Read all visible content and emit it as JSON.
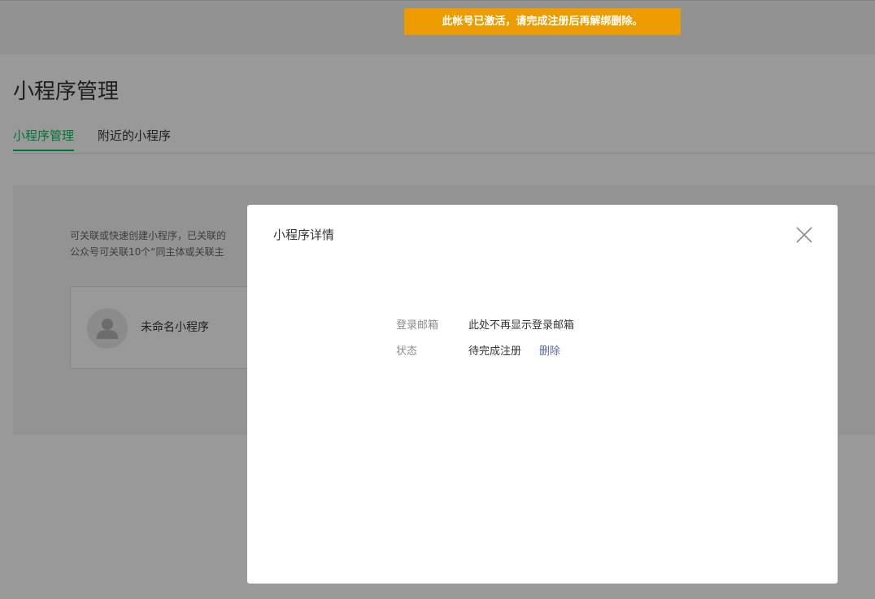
{
  "page": {
    "title": "小程序管理",
    "tabs": [
      {
        "label": "小程序管理",
        "active": true
      },
      {
        "label": "附近的小程序",
        "active": false
      }
    ],
    "description_line1": "可关联或快速创建小程序，已关联的",
    "description_line2": "公众号可关联10个“同主体或关联主",
    "card": {
      "name": "未命名小程序",
      "avatar_icon": "user-silhouette-icon"
    }
  },
  "notice": {
    "text": "此帐号已激活，请完成注册后再解绑删除。",
    "color": "#ec9c00"
  },
  "dialog": {
    "title": "小程序详情",
    "close_icon": "close-icon",
    "rows": [
      {
        "label": "登录邮箱",
        "value": "此处不再显示登录邮箱"
      },
      {
        "label": "状态",
        "value": "待完成注册",
        "action": "删除"
      }
    ]
  },
  "colors": {
    "accent": "#07c160",
    "link": "#576b95"
  }
}
